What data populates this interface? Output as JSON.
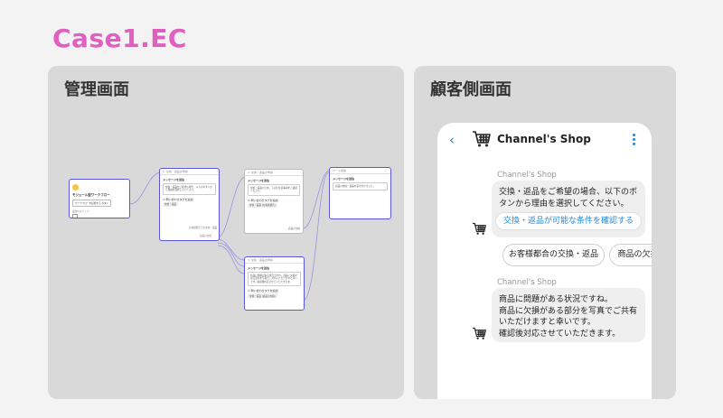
{
  "page": {
    "title": "Case1.EC"
  },
  "admin_panel": {
    "title": "管理画面",
    "flow": {
      "start_node": {
        "title": "モジュール型ワークフロー",
        "button": "ワークフローを起動する ボタン",
        "note": "最新のステップ"
      },
      "nodes": [
        {
          "header": "1. 交換・返品の申請",
          "label": "メッセージを送信",
          "message": "交換・返品をご希望の場合、以下のボタンから理由を選択してください。",
          "sub": "☑ 問い合わせタグを追加",
          "chip": "交換・返品",
          "link": "お客様都合での交換・返品"
        },
        {
          "header": "2. 交換・返品の申請",
          "label": "メッセージを送信",
          "message": "交換・返品のため、下記の注意事項をご確認ください。",
          "sub": "☑ 問い合わせタグを追加",
          "chip": "交換・返品 (お客様都合)",
          "link": "商品の欠損"
        },
        {
          "header": "3. 交換・返品の申請",
          "label": "メッセージを送信",
          "message": "商品に問題がある状況ですね。商品に欠損がある部分を写真でご共有いただけますと幸いです。確認後対応させていただきます。",
          "sub": "☑ 問い合わせタグを追加",
          "chip": "交換・返品 (商品の欠損)",
          "link": ""
        },
        {
          "header": "カード送信",
          "label": "メッセージを送信",
          "message": "商品の交換・返品を受け付けました。",
          "sub": "",
          "chip": "",
          "link": ""
        }
      ]
    }
  },
  "customer_panel": {
    "title": "顧客側画面",
    "header": {
      "shop_name": "Channel's Shop",
      "back_icon": "chevron-left-icon",
      "cart_icon": "shopping-cart-icon",
      "menu_icon": "kebab-menu-icon"
    },
    "messages": [
      {
        "sender": "Channel's Shop",
        "text": [
          "交換・返品をご希望の場合、以下のボ",
          "タンから理由を選択してください。"
        ],
        "button": "交換・返品が可能な条件を確認する"
      },
      {
        "sender": "Channel's Shop",
        "text": [
          "商品に問題がある状況ですね。",
          "商品に欠損がある部分を写真でご共有",
          "いただけますと幸いです。",
          "確認後対応させていただきます。"
        ]
      }
    ],
    "quick_replies": [
      "お客様都合の交換・返品",
      "商品の欠損"
    ]
  },
  "colors": {
    "title": "#e05fc0",
    "panel_bg": "#d9d9d9",
    "accent": "#1e88e5",
    "node_border": "#5a57d6",
    "bubble": "#efefef"
  }
}
